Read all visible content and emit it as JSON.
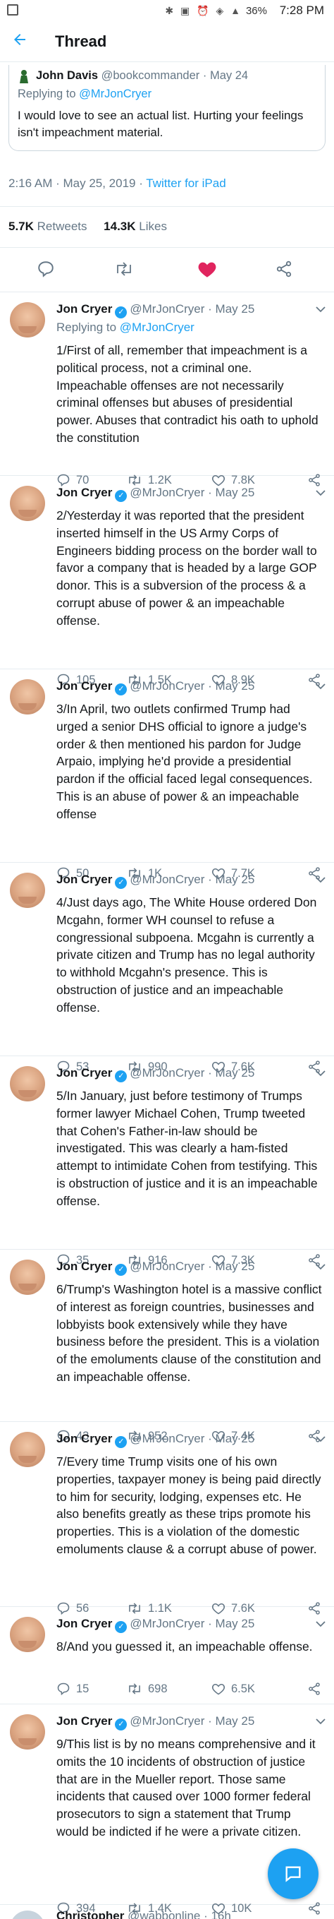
{
  "status_bar": {
    "battery": "36%",
    "time": "7:28 PM"
  },
  "header": {
    "title": "Thread"
  },
  "quoted_tweet": {
    "name": "John Davis",
    "handle": "@bookcommander",
    "date": "· May 24",
    "replying_prefix": "Replying to",
    "replying_mention": "@MrJonCryer",
    "text": "I would love to see an actual list. Hurting your feelings isn't impeachment material."
  },
  "focused_meta": {
    "timestamp": "2:16 AM · May 25, 2019 · ",
    "client": "Twitter for iPad"
  },
  "stats": {
    "retweets_count": "5.7K",
    "retweets_label": "Retweets",
    "likes_count": "14.3K",
    "likes_label": "Likes"
  },
  "action_bar": {
    "icons": [
      "reply-icon",
      "retweet-icon",
      "like-icon-filled",
      "share-icon"
    ],
    "like_color": "#e0245e"
  },
  "tweets": [
    {
      "name": "Jon Cryer",
      "handle": "@MrJonCryer",
      "date": "· May 25",
      "replying_prefix": "Replying to",
      "replying_mention": "@MrJonCryer",
      "text": "1/First of all, remember that impeachment is a political process, not a criminal one. Impeachable offenses are not necessarily criminal offenses but abuses of presidential power. Abuses that contradict his oath to uphold the constitution",
      "replies": "70",
      "retweets": "1.2K",
      "likes": "7.8K"
    },
    {
      "name": "Jon Cryer",
      "handle": "@MrJonCryer",
      "date": "· May 25",
      "text": "2/Yesterday it was reported that the president inserted himself in the US Army Corps of Engineers bidding process on the border wall to favor a company that is headed by a large GOP donor. This is a subversion of the process & a corrupt abuse of power & an impeachable offense.",
      "replies": "105",
      "retweets": "1.5K",
      "likes": "8.9K"
    },
    {
      "name": "Jon Cryer",
      "handle": "@MrJonCryer",
      "date": "· May 25",
      "text": "3/In April, two outlets confirmed Trump had urged a senior DHS official to ignore a judge's order & then mentioned his pardon for Judge Arpaio, implying he'd provide a presidential pardon if the official faced legal consequences. This is an abuse of power & an impeachable offense",
      "replies": "50",
      "retweets": "1K",
      "likes": "7.7K"
    },
    {
      "name": "Jon Cryer",
      "handle": "@MrJonCryer",
      "date": "· May 25",
      "text": "4/Just days ago, The White House ordered Don Mcgahn, former WH counsel to refuse a congressional subpoena. Mcgahn is currently a private citizen and Trump has no legal authority to withhold Mcgahn's presence. This is obstruction of justice and an impeachable offense.",
      "replies": "53",
      "retweets": "990",
      "likes": "7.6K"
    },
    {
      "name": "Jon Cryer",
      "handle": "@MrJonCryer",
      "date": "· May 25",
      "text": "5/In January, just before testimony of Trumps former lawyer Michael Cohen, Trump tweeted that Cohen's Father-in-law should be investigated. This was clearly a ham-fisted attempt to intimidate Cohen from testifying. This is obstruction of justice and it is an impeachable offense.",
      "replies": "35",
      "retweets": "916",
      "likes": "7.3K"
    },
    {
      "name": "Jon Cryer",
      "handle": "@MrJonCryer",
      "date": "· May 25",
      "text": "6/Trump's Washington hotel is a massive conflict of interest as foreign countries, businesses and lobbyists book extensively while they have business before the president. This is a violation of the emoluments clause of the constitution and an impeachable offense.",
      "replies": "43",
      "retweets": "952",
      "likes": "7.4K"
    },
    {
      "name": "Jon Cryer",
      "handle": "@MrJonCryer",
      "date": "· May 25",
      "text": "7/Every time Trump visits one of his own properties, taxpayer money is being paid directly to him for security, lodging, expenses etc. He also benefits greatly as these trips promote his properties. This is a violation of the domestic emoluments clause & a corrupt abuse of power.",
      "replies": "56",
      "retweets": "1.1K",
      "likes": "7.6K"
    },
    {
      "name": "Jon Cryer",
      "handle": "@MrJonCryer",
      "date": "· May 25",
      "text": "8/And you guessed it, an impeachable offense.",
      "replies": "15",
      "retweets": "698",
      "likes": "6.5K"
    },
    {
      "name": "Jon Cryer",
      "handle": "@MrJonCryer",
      "date": "· May 25",
      "text": "9/This list is by no means comprehensive and it omits the 10 incidents of obstruction of justice that are in the Mueller report. Those same incidents that caused over 1000 former federal prosecutors to sign a statement that Trump would be indicted if he were a private citizen.",
      "replies": "394",
      "retweets": "1.4K",
      "likes": "10K"
    }
  ],
  "next_tweet": {
    "name": "Christopher",
    "handle": "@wabbonline",
    "date": "· 16h"
  },
  "colors": {
    "accent": "#1da1f2",
    "text": "#14171a",
    "muted": "#657786",
    "divider": "#e6ecf0"
  }
}
